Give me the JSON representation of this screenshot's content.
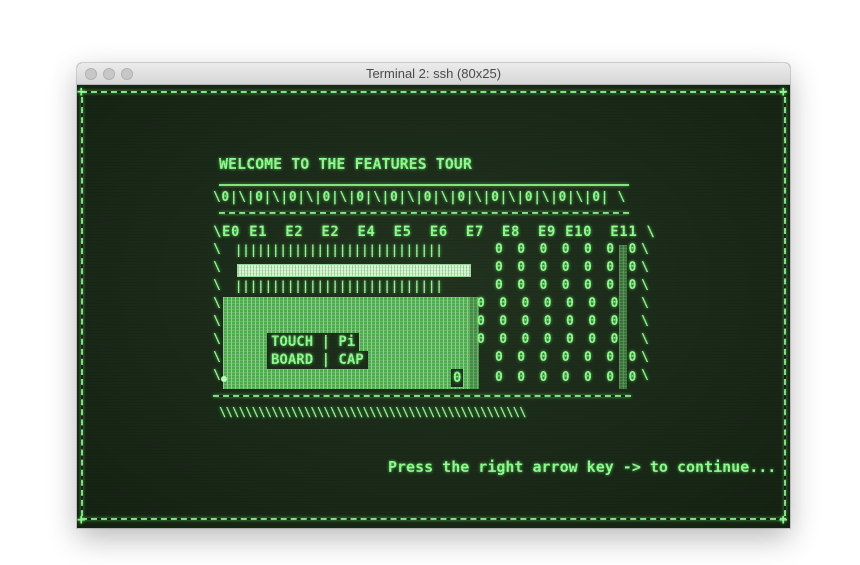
{
  "window": {
    "title": "Terminal 2: ssh (80x25)"
  },
  "terminal": {
    "heading": "WELCOME TO THE FEATURES TOUR",
    "top_row": "\\0|\\|0|\\|0|\\|0|\\|0|\\|0|\\|0|\\|0|\\|0|\\|0|\\|0|\\|0| \\",
    "electrode_row": "\\E0 E1  E2  E2  E4  E5  E6  E7  E8  E9 E10  E11 \\",
    "pipes_row": "||||||||||||||||||||||||||||",
    "zeros_row": "0 0 0 0 0 0 0",
    "label_line1": "TOUCH | Pi",
    "label_line2": "BOARD | CAP",
    "mid_zero": "0",
    "slashes_row": "\\\\\\\\\\\\\\\\\\\\\\\\\\\\\\\\\\\\\\\\\\\\\\\\\\\\\\\\\\\\\\\\\\\\\\\\\\\\\\\\\\\\\\\\\\\\\\",
    "continue_prompt": "Press the right arrow key -> to continue...",
    "border_left_char": "\\"
  }
}
